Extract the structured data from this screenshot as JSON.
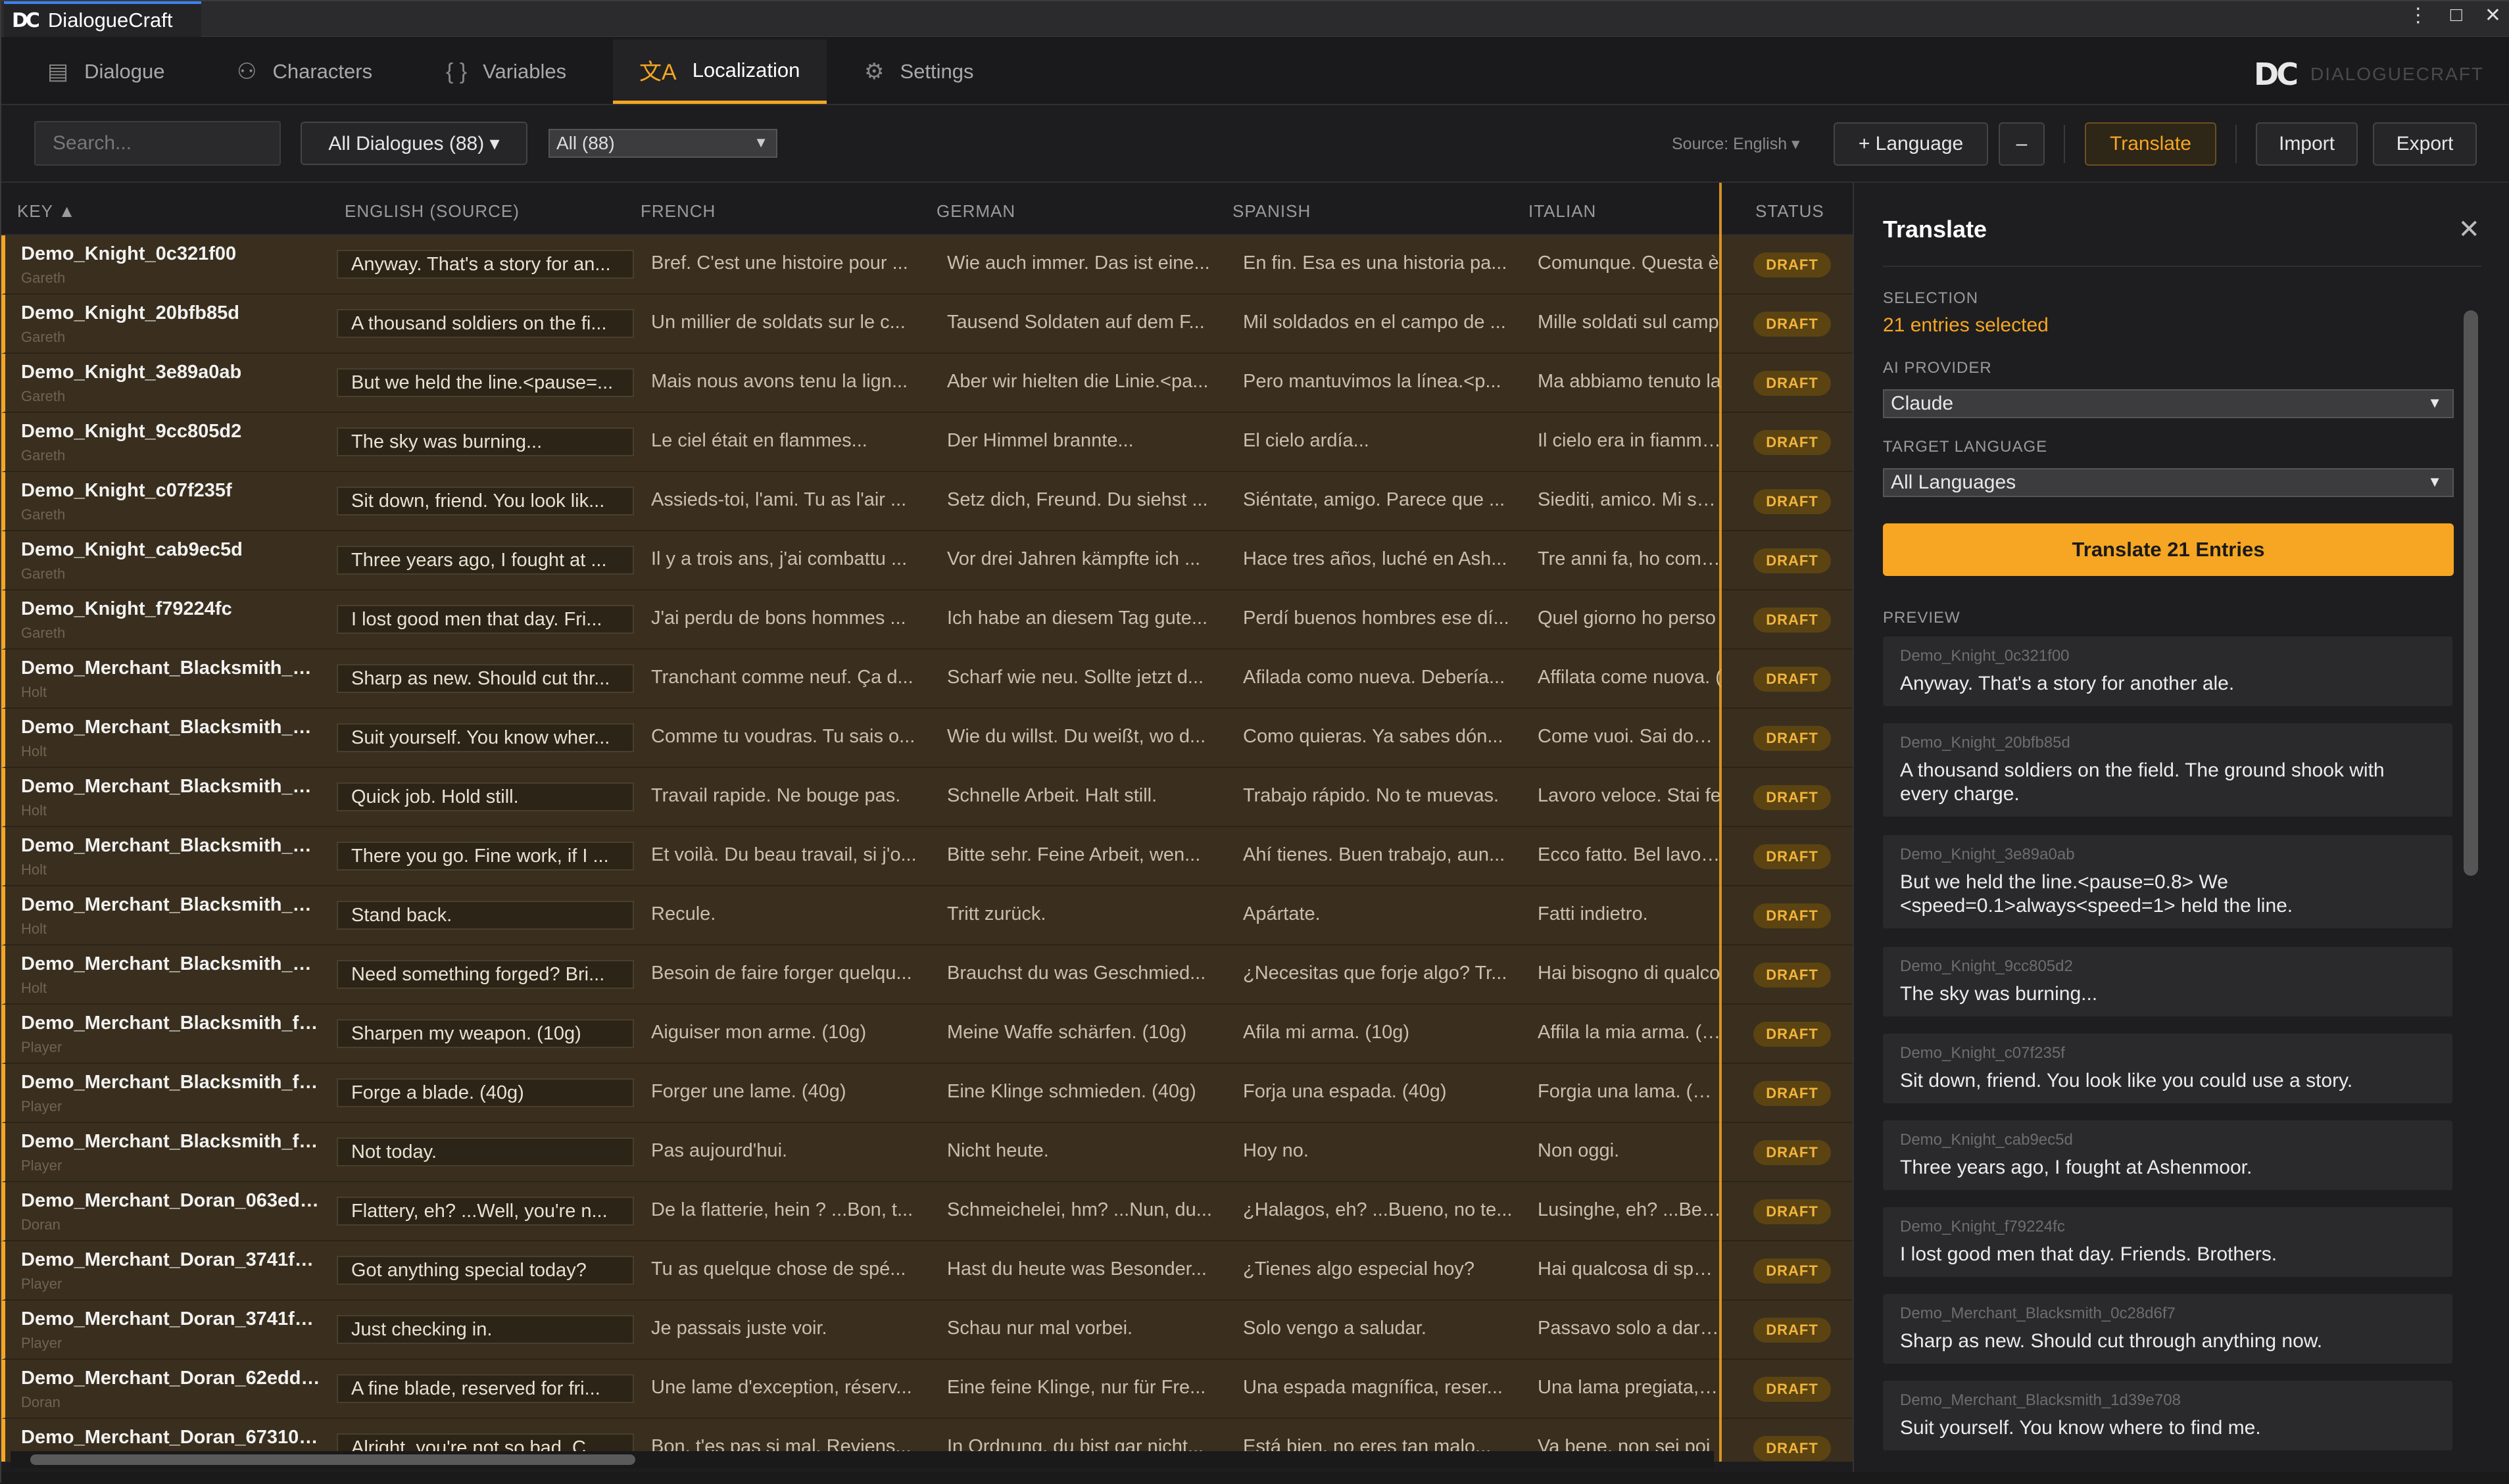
{
  "titlebar": {
    "logo": "DC",
    "title": "DialogueCraft",
    "more": "⋮",
    "maximize": "□",
    "close": "✕"
  },
  "nav": {
    "tabs": [
      {
        "label": "Dialogue",
        "icon": "▤"
      },
      {
        "label": "Characters",
        "icon": "⚇"
      },
      {
        "label": "Variables",
        "icon": "{ }"
      },
      {
        "label": "Localization",
        "icon": "文A"
      },
      {
        "label": "Settings",
        "icon": "⚙"
      }
    ],
    "brand": "DIALOGUECRAFT",
    "brand_logo": "DC"
  },
  "toolbar": {
    "search_placeholder": "Search...",
    "filter_label": "All Dialogues (88) ▾",
    "status_select": "All (88)",
    "source": "Source: English ▾",
    "add_language": "+ Language",
    "remove_language": "–",
    "translate": "Translate",
    "import": "Import",
    "export": "Export"
  },
  "table": {
    "headers": {
      "key": "KEY ▲",
      "english": "ENGLISH (SOURCE)",
      "french": "FRENCH",
      "german": "GERMAN",
      "spanish": "SPANISH",
      "italian": "ITALIAN",
      "status": "STATUS"
    },
    "rows": [
      {
        "key": "Demo_Knight_0c321f00",
        "speaker": "Gareth",
        "en": "Anyway. That's a story for an...",
        "fr": "Bref. C'est une histoire pour ...",
        "de": "Wie auch immer. Das ist eine...",
        "es": "En fin. Esa es una historia pa...",
        "it": "Comunque. Questa è",
        "status": "DRAFT"
      },
      {
        "key": "Demo_Knight_20bfb85d",
        "speaker": "Gareth",
        "en": "A thousand soldiers on the fi...",
        "fr": "Un millier de soldats sur le c...",
        "de": "Tausend Soldaten auf dem F...",
        "es": "Mil soldados en el campo de ...",
        "it": "Mille soldati sul camp",
        "status": "DRAFT"
      },
      {
        "key": "Demo_Knight_3e89a0ab",
        "speaker": "Gareth",
        "en": "But we held the line.<pause=...",
        "fr": "Mais nous avons tenu la lign...",
        "de": "Aber wir hielten die Linie.<pa...",
        "es": "Pero mantuvimos la línea.<p...",
        "it": "Ma abbiamo tenuto la",
        "status": "DRAFT"
      },
      {
        "key": "Demo_Knight_9cc805d2",
        "speaker": "Gareth",
        "en": "The sky was burning...",
        "fr": "Le ciel était en flammes...",
        "de": "Der Himmel brannte...",
        "es": "El cielo ardía...",
        "it": "Il cielo era in fiamme...",
        "status": "DRAFT"
      },
      {
        "key": "Demo_Knight_c07f235f",
        "speaker": "Gareth",
        "en": "Sit down, friend. You look lik...",
        "fr": "Assieds-toi, l'ami. Tu as l'air ...",
        "de": "Setz dich, Freund. Du siehst ...",
        "es": "Siéntate, amigo. Parece que ...",
        "it": "Siediti, amico. Mi sem",
        "status": "DRAFT"
      },
      {
        "key": "Demo_Knight_cab9ec5d",
        "speaker": "Gareth",
        "en": "Three years ago, I fought at ...",
        "fr": "Il y a trois ans, j'ai combattu ...",
        "de": "Vor drei Jahren kämpfte ich ...",
        "es": "Hace tres años, luché en Ash...",
        "it": "Tre anni fa, ho comba",
        "status": "DRAFT"
      },
      {
        "key": "Demo_Knight_f79224fc",
        "speaker": "Gareth",
        "en": "I lost good men that day. Fri...",
        "fr": "J'ai perdu de bons hommes ...",
        "de": "Ich habe an diesem Tag gute...",
        "es": "Perdí buenos hombres ese dí...",
        "it": "Quel giorno ho perso",
        "status": "DRAFT"
      },
      {
        "key": "Demo_Merchant_Blacksmith_0c...",
        "speaker": "Holt",
        "en": "Sharp as new. Should cut thr...",
        "fr": "Tranchant comme neuf. Ça d...",
        "de": "Scharf wie neu. Sollte jetzt d...",
        "es": "Afilada como nueva. Debería...",
        "it": "Affilata come nuova. (",
        "status": "DRAFT"
      },
      {
        "key": "Demo_Merchant_Blacksmith_1d...",
        "speaker": "Holt",
        "en": "Suit yourself. You know wher...",
        "fr": "Comme tu voudras. Tu sais o...",
        "de": "Wie du willst. Du weißt, wo d...",
        "es": "Como quieras. Ya sabes dón...",
        "it": "Come vuoi. Sai dove t",
        "status": "DRAFT"
      },
      {
        "key": "Demo_Merchant_Blacksmith_36...",
        "speaker": "Holt",
        "en": "Quick job. Hold still.",
        "fr": "Travail rapide. Ne bouge pas.",
        "de": "Schnelle Arbeit. Halt still.",
        "es": "Trabajo rápido. No te muevas.",
        "it": "Lavoro veloce. Stai fe",
        "status": "DRAFT"
      },
      {
        "key": "Demo_Merchant_Blacksmith_4c...",
        "speaker": "Holt",
        "en": "There you go. Fine work, if I ...",
        "fr": "Et voilà. Du beau travail, si j'o...",
        "de": "Bitte sehr. Feine Arbeit, wen...",
        "es": "Ahí tienes. Buen trabajo, aun...",
        "it": "Ecco fatto. Bel lavoro,",
        "status": "DRAFT"
      },
      {
        "key": "Demo_Merchant_Blacksmith_ad...",
        "speaker": "Holt",
        "en": "Stand back.",
        "fr": "Recule.",
        "de": "Tritt zurück.",
        "es": "Apártate.",
        "it": "Fatti indietro.",
        "status": "DRAFT"
      },
      {
        "key": "Demo_Merchant_Blacksmith_da...",
        "speaker": "Holt",
        "en": "Need something forged? Bri...",
        "fr": "Besoin de faire forger quelqu...",
        "de": "Brauchst du was Geschmied...",
        "es": "¿Necesitas que forje algo? Tr...",
        "it": "Hai bisogno di qualco",
        "status": "DRAFT"
      },
      {
        "key": "Demo_Merchant_Blacksmith_f2...",
        "speaker": "Player",
        "en": "Sharpen my weapon. (10g)",
        "fr": "Aiguiser mon arme. (10g)",
        "de": "Meine Waffe schärfen. (10g)",
        "es": "Afila mi arma. (10g)",
        "it": "Affila la mia arma. (10",
        "status": "DRAFT"
      },
      {
        "key": "Demo_Merchant_Blacksmith_f2...",
        "speaker": "Player",
        "en": "Forge a blade. (40g)",
        "fr": "Forger une lame. (40g)",
        "de": "Eine Klinge schmieden. (40g)",
        "es": "Forja una espada. (40g)",
        "it": "Forgia una lama. (40g",
        "status": "DRAFT"
      },
      {
        "key": "Demo_Merchant_Blacksmith_f2...",
        "speaker": "Player",
        "en": "Not today.",
        "fr": "Pas aujourd'hui.",
        "de": "Nicht heute.",
        "es": "Hoy no.",
        "it": "Non oggi.",
        "status": "DRAFT"
      },
      {
        "key": "Demo_Merchant_Doran_063ed6...",
        "speaker": "Doran",
        "en": "Flattery, eh? ...Well, you're n...",
        "fr": "De la flatterie, hein ? ...Bon, t...",
        "de": "Schmeichelei, hm? ...Nun, du...",
        "es": "¿Halagos, eh? ...Bueno, no te...",
        "it": "Lusinghe, eh? ...Beh, r",
        "status": "DRAFT"
      },
      {
        "key": "Demo_Merchant_Doran_3741f1...",
        "speaker": "Player",
        "en": "Got anything special today?",
        "fr": "Tu as quelque chose de spé...",
        "de": "Hast du heute was Besonder...",
        "es": "¿Tienes algo especial hoy?",
        "it": "Hai qualcosa di specia",
        "status": "DRAFT"
      },
      {
        "key": "Demo_Merchant_Doran_3741f1...",
        "speaker": "Player",
        "en": "Just checking in.",
        "fr": "Je passais juste voir.",
        "de": "Schau nur mal vorbei.",
        "es": "Solo vengo a saludar.",
        "it": "Passavo solo a dare u",
        "status": "DRAFT"
      },
      {
        "key": "Demo_Merchant_Doran_62edd5...",
        "speaker": "Doran",
        "en": "A fine blade, reserved for fri...",
        "fr": "Une lame d'exception, réserv...",
        "de": "Eine feine Klinge, nur für Fre...",
        "es": "Una espada magnífica, reser...",
        "it": "Una lama pregiata, ris",
        "status": "DRAFT"
      },
      {
        "key": "Demo_Merchant_Doran_67310a...",
        "speaker": "",
        "en": "Alright, you're not so bad. C...",
        "fr": "Bon, t'es pas si mal. Reviens...",
        "de": "In Ordnung, du bist gar nicht...",
        "es": "Está bien, no eres tan malo...",
        "it": "Va bene, non sei poi",
        "status": "DRAFT"
      }
    ]
  },
  "panel": {
    "title": "Translate",
    "close": "✕",
    "selection_label": "SELECTION",
    "selection_value": "21 entries selected",
    "provider_label": "AI PROVIDER",
    "provider_value": "Claude",
    "target_label": "TARGET LANGUAGE",
    "target_value": "All Languages",
    "translate_button": "Translate 21 Entries",
    "preview_label": "PREVIEW",
    "preview": [
      {
        "key": "Demo_Knight_0c321f00",
        "text": "Anyway. That's a story for another ale."
      },
      {
        "key": "Demo_Knight_20bfb85d",
        "text": "A thousand soldiers on the field. The ground shook with every charge."
      },
      {
        "key": "Demo_Knight_3e89a0ab",
        "text": "But we held the line.<pause=0.8> We <speed=0.1>always<speed=1> held the line."
      },
      {
        "key": "Demo_Knight_9cc805d2",
        "text": "The sky was burning..."
      },
      {
        "key": "Demo_Knight_c07f235f",
        "text": "Sit down, friend. You look like you could use a story."
      },
      {
        "key": "Demo_Knight_cab9ec5d",
        "text": "Three years ago, I fought at Ashenmoor."
      },
      {
        "key": "Demo_Knight_f79224fc",
        "text": "I lost good men that day. Friends. Brothers."
      },
      {
        "key": "Demo_Merchant_Blacksmith_0c28d6f7",
        "text": "Sharp as new. Should cut through anything now."
      },
      {
        "key": "Demo_Merchant_Blacksmith_1d39e708",
        "text": "Suit yourself. You know where to find me."
      }
    ]
  }
}
